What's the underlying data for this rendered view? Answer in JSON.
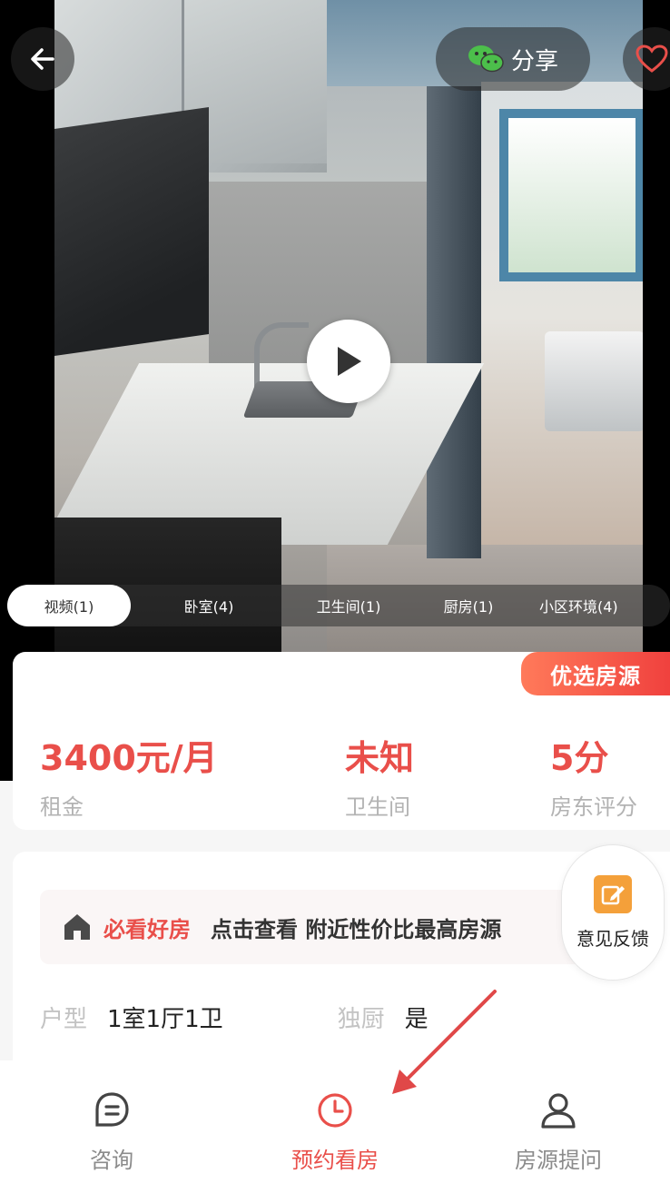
{
  "header": {
    "share_label": "分享"
  },
  "media_tabs": [
    {
      "label": "视频(1)",
      "active": true
    },
    {
      "label": "卧室(4)",
      "active": false
    },
    {
      "label": "卫生间(1)",
      "active": false
    },
    {
      "label": "厨房(1)",
      "active": false
    },
    {
      "label": "小区环境(4)",
      "active": false
    }
  ],
  "price_card": {
    "badge": "优选房源",
    "stats": [
      {
        "value": "3400元/月",
        "label": "租金"
      },
      {
        "value": "未知",
        "label": "卫生间"
      },
      {
        "value": "5分",
        "label": "房东评分"
      }
    ]
  },
  "promo": {
    "tag": "必看好房",
    "text": "点击查看 附近性价比最高房源"
  },
  "feedback": {
    "label": "意见反馈"
  },
  "attributes": [
    {
      "key": "户型",
      "value": "1室1厅1卫"
    },
    {
      "key": "独厨",
      "value": "是"
    }
  ],
  "bottom_nav": [
    {
      "label": "咨询",
      "icon": "chat-icon",
      "active": false
    },
    {
      "label": "预约看房",
      "icon": "clock-icon",
      "active": true
    },
    {
      "label": "房源提问",
      "icon": "person-icon",
      "active": false
    }
  ],
  "colors": {
    "accent": "#e94f4a",
    "badge_gradient_start": "#ff7a5a",
    "badge_gradient_end": "#f0413e",
    "feedback_icon": "#f4a03a",
    "wechat_green": "#4cbf4b"
  }
}
